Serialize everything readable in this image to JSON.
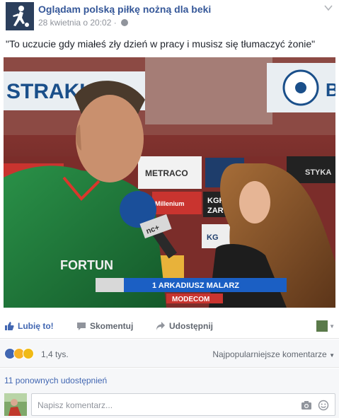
{
  "post": {
    "page_name": "Oglądam polską piłkę nożną dla beki",
    "timestamp": "28 kwietnia o 20:02",
    "separator": "·",
    "text": "\"To uczucie gdy miałeś zły dzień w pracy i musisz się tłumaczyć żonie\""
  },
  "photo": {
    "banner_top_left": "STRAKU",
    "board_metraco": "METRACO",
    "board_millenium": "Millenium",
    "board_kgh": "KGH",
    "board_zar": "ZAR",
    "board_kgh2": "KG",
    "board_styka": "STYKA",
    "board_b": "B",
    "shirt_sponsor": "FORTUN",
    "mic_label": "nc+",
    "lower_third": "1 ARKADIUSZ MALARZ",
    "lower_third_sponsor": "MODECOM"
  },
  "actions": {
    "like": "Lubię to!",
    "comment": "Skomentuj",
    "share": "Udostępnij"
  },
  "reactions": {
    "count": "1,4 tys.",
    "sort": "Najpopularniejsze komentarze"
  },
  "shares": {
    "label": "11 ponownych udostępnień"
  },
  "comment": {
    "placeholder": "Napisz komentarz..."
  },
  "colors": {
    "link_blue": "#365899",
    "like_blue": "#4267b2",
    "muted_gray": "#90949c",
    "shirt_green": "#1f7a3a"
  }
}
